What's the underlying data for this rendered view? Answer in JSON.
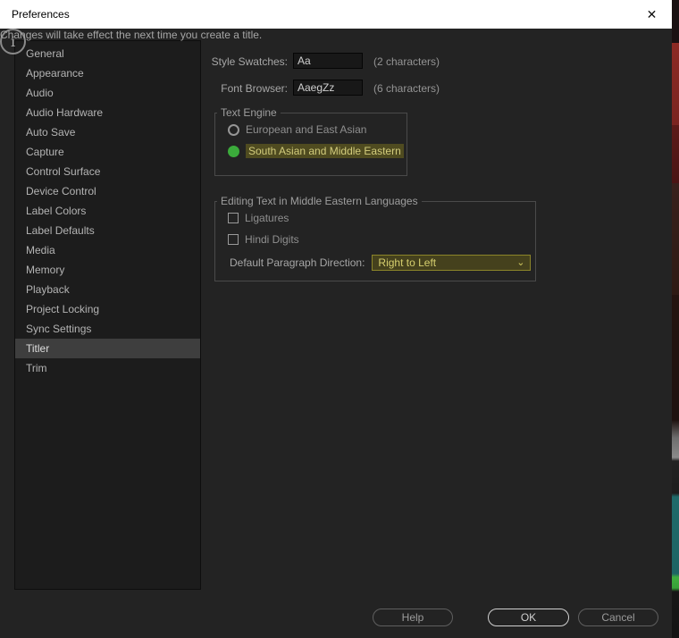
{
  "window": {
    "title": "Preferences"
  },
  "icons": {
    "close": "✕",
    "chevron_down": "⌄",
    "info": "i"
  },
  "sidebar": {
    "items": [
      {
        "label": "General"
      },
      {
        "label": "Appearance"
      },
      {
        "label": "Audio"
      },
      {
        "label": "Audio Hardware"
      },
      {
        "label": "Auto Save"
      },
      {
        "label": "Capture"
      },
      {
        "label": "Control Surface"
      },
      {
        "label": "Device Control"
      },
      {
        "label": "Label Colors"
      },
      {
        "label": "Label Defaults"
      },
      {
        "label": "Media"
      },
      {
        "label": "Memory"
      },
      {
        "label": "Playback"
      },
      {
        "label": "Project Locking"
      },
      {
        "label": "Sync Settings"
      },
      {
        "label": "Titler",
        "selected": true
      },
      {
        "label": "Trim"
      }
    ]
  },
  "content": {
    "style_swatches": {
      "label": "Style Swatches:",
      "value": "Aa",
      "hint": "(2 characters)"
    },
    "font_browser": {
      "label": "Font Browser:",
      "value": "AaegZz",
      "hint": "(6 characters)"
    },
    "text_engine": {
      "title": "Text Engine",
      "options": [
        {
          "label": "European and East Asian",
          "selected": false
        },
        {
          "label": "South Asian and Middle Eastern",
          "selected": true,
          "highlighted": true
        }
      ]
    },
    "middle_eastern_group": {
      "title": "Editing Text in Middle Eastern Languages",
      "checkboxes": [
        {
          "label": "Ligatures",
          "checked": false
        },
        {
          "label": "Hindi Digits",
          "checked": false
        }
      ],
      "paragraph_direction": {
        "label": "Default Paragraph Direction:",
        "value": "Right to Left"
      }
    },
    "info_message": "Changes will take effect the next time you create a title."
  },
  "footer": {
    "help": "Help",
    "ok": "OK",
    "cancel": "Cancel"
  },
  "colors": {
    "accent_green": "#3bab3b",
    "highlight_bg": "#4f4b20",
    "highlight_text": "#d2cc7c"
  }
}
